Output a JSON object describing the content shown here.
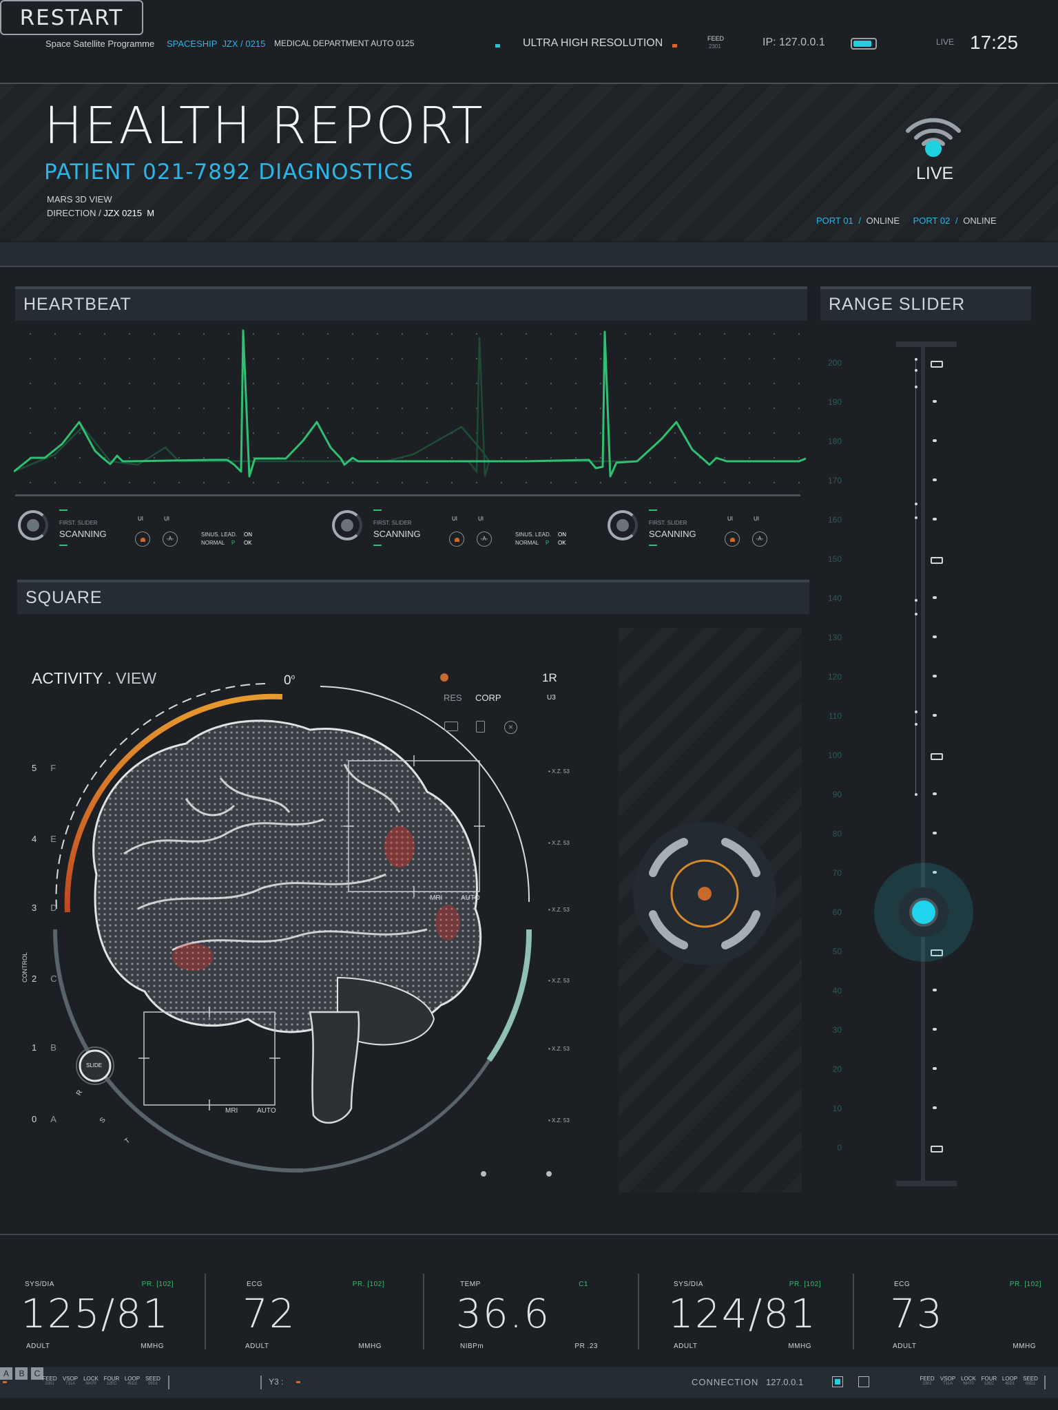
{
  "topbar": {
    "program": "Space Satellite Programme",
    "spaceship": "SPACESHIP  JZX / 0215",
    "department": "MEDICAL DEPARTMENT AUTO 0125",
    "resolution": "ULTRA HIGH RESOLUTION",
    "feed_label": "FEED",
    "feed_value": "2301",
    "ip": "IP: 127.0.0.1",
    "live": "LIVE",
    "time": "17:25",
    "battery_level": 0.85
  },
  "header": {
    "title": "HEALTH REPORT",
    "subtitle": "PATIENT 021-7892 DIAGNOSTICS",
    "view": "MARS 3D VIEW",
    "direction_label": "DIRECTION /",
    "direction_value": "JZX 0215  M",
    "live": "LIVE",
    "ports": [
      {
        "name": "PORT 01",
        "sep": "/",
        "status": "ONLINE"
      },
      {
        "name": "PORT 02",
        "sep": "/",
        "status": "ONLINE"
      }
    ]
  },
  "heartbeat": {
    "title": "HEARTBEAT",
    "controls": [
      {
        "slider_label": "FIRST. SLIDER",
        "status": "SCANNING",
        "ui1": "UI",
        "ui2": "UI",
        "btn_a": "-A-",
        "sinus": "SINUS. LEAD.",
        "sinus_val": "ON",
        "normal": "NORMAL",
        "p": "P",
        "ok": "OK"
      },
      {
        "slider_label": "FIRST. SLIDER",
        "status": "SCANNING",
        "ui1": "UI",
        "ui2": "UI",
        "btn_a": "-A-",
        "sinus": "SINUS. LEAD.",
        "sinus_val": "ON",
        "normal": "NORMAL",
        "p": "P",
        "ok": "OK"
      },
      {
        "slider_label": "FIRST. SLIDER",
        "status": "SCANNING",
        "ui1": "UI",
        "ui2": "UI",
        "btn_a": "-A-"
      }
    ]
  },
  "square": {
    "title": "SQUARE",
    "activity": "ACTIVITY",
    "view": ". VIEW",
    "angle": "0",
    "angle_unit": "o",
    "res": "RES",
    "corp": "CORP",
    "r1": "1R",
    "u3": "U3",
    "levels": [
      {
        "num": "5",
        "letter": "F"
      },
      {
        "num": "4",
        "letter": "E"
      },
      {
        "num": "3",
        "letter": "D"
      },
      {
        "num": "2",
        "letter": "C"
      },
      {
        "num": "1",
        "letter": "B"
      },
      {
        "num": "0",
        "letter": "A"
      }
    ],
    "control": "CONTROL",
    "slide": "SLIDE",
    "arc_letters": [
      "R",
      "S",
      "T"
    ],
    "xz_labels": [
      "X.Z. 53",
      "X.Z. 53",
      "X.Z. 53",
      "X.Z. 53",
      "X.Z. 53",
      "X.Z. 53"
    ],
    "box_labels": {
      "mri": "MRI",
      "auto": "AUTO"
    },
    "restart": "RESTART"
  },
  "range_slider": {
    "title": "RANGE SLIDER",
    "scale": [
      "200",
      "190",
      "180",
      "170",
      "160",
      "150",
      "140",
      "130",
      "120",
      "110",
      "100",
      "90",
      "80",
      "70",
      "60",
      "50",
      "40",
      "30",
      "20",
      "10",
      "0"
    ],
    "value": 60
  },
  "vitals": [
    {
      "label": "SYS/DIA",
      "tag": "PR. [102]",
      "value": "125/81",
      "foot_left": "ADULT",
      "foot_right": "MMHG"
    },
    {
      "label": "ECG",
      "tag": "PR. [102]",
      "value": "72",
      "foot_left": "ADULT",
      "foot_right": "MMHG"
    },
    {
      "label": "TEMP",
      "tag": "C1",
      "value": "36.6",
      "foot_left": "NIBPm",
      "foot_right": "PR .23"
    },
    {
      "label": "SYS/DIA",
      "tag": "PR. [102]",
      "value": "124/81",
      "foot_left": "ADULT",
      "foot_right": "MMHG"
    },
    {
      "label": "ECG",
      "tag": "PR. [102]",
      "value": "73",
      "foot_left": "ADULT",
      "foot_right": "MMHG"
    }
  ],
  "statusbar": {
    "codes_left": [
      {
        "k": "FEED",
        "v": "2301"
      },
      {
        "k": "VSOP",
        "v": "T11A"
      },
      {
        "k": "LOCK",
        "v": "NH70"
      },
      {
        "k": "FOUR",
        "v": "12EC"
      },
      {
        "k": "LOOP",
        "v": "45D1"
      },
      {
        "k": "SEED",
        "v": "09D1"
      }
    ],
    "buttons": [
      "A",
      "B",
      "C"
    ],
    "y3": "Y3 :",
    "connection": "CONNECTION",
    "ip": "127.0.0.1",
    "codes_right": [
      {
        "k": "FEED",
        "v": "2301"
      },
      {
        "k": "VSOP",
        "v": "T11A"
      },
      {
        "k": "LOCK",
        "v": "NH70"
      },
      {
        "k": "FOUR",
        "v": "12EC"
      },
      {
        "k": "LOOP",
        "v": "45D1"
      },
      {
        "k": "SEED",
        "v": "09D1"
      }
    ]
  }
}
